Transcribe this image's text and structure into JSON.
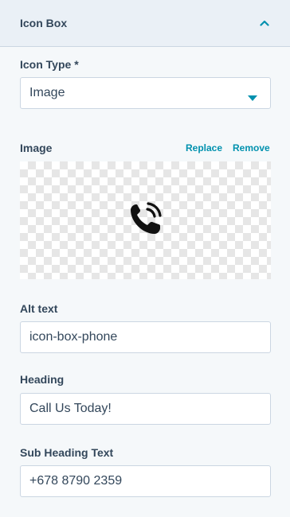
{
  "header": {
    "title": "Icon Box",
    "collapse_icon": "chevron-up-icon"
  },
  "icon_type": {
    "label": "Icon Type *",
    "value": "Image",
    "caret_icon": "caret-down-icon"
  },
  "image": {
    "label": "Image",
    "replace_label": "Replace",
    "remove_label": "Remove",
    "preview_icon": "phone-ringing-icon"
  },
  "alt_text": {
    "label": "Alt text",
    "value": "icon-box-phone"
  },
  "heading": {
    "label": "Heading",
    "value": "Call Us Today!"
  },
  "sub_heading": {
    "label": "Sub Heading Text",
    "value": "+678 8790 2359"
  },
  "colors": {
    "accent": "#0091ae",
    "text": "#33475b",
    "header_bg": "#eaf0f6",
    "panel_bg": "#f5f8fa",
    "border": "#cbd6e2"
  }
}
